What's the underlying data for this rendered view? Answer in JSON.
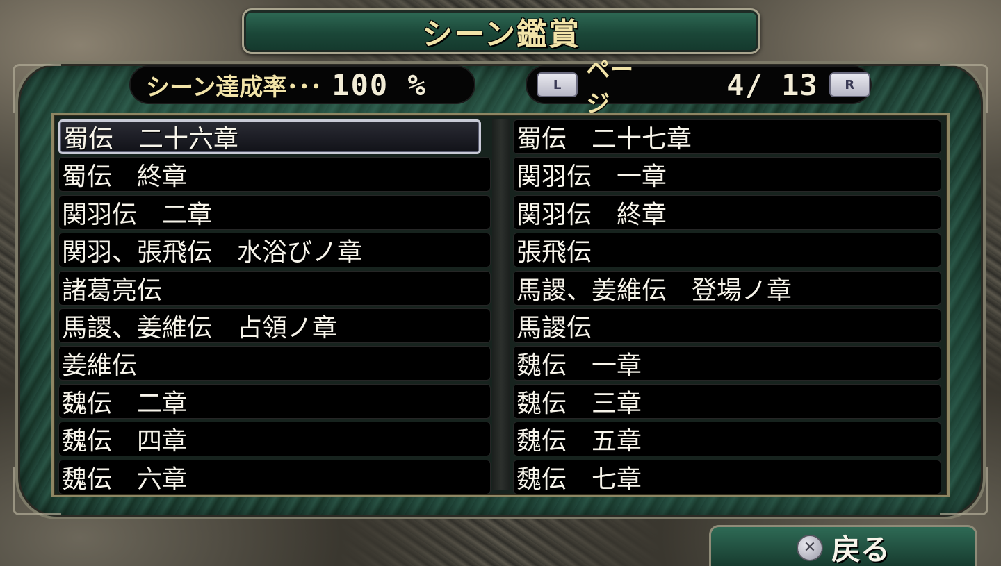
{
  "title": "シーン鑑賞",
  "completion": {
    "label": "シーン達成率･･･",
    "value": "100 %"
  },
  "pager": {
    "l_button": "L",
    "label": "ページ",
    "value": "4/ 13",
    "r_button": "R"
  },
  "scenes": {
    "left": [
      "蜀伝　二十六章",
      "蜀伝　終章",
      "関羽伝　二章",
      "関羽、張飛伝　水浴びノ章",
      "諸葛亮伝",
      "馬謖、姜維伝　占領ノ章",
      "姜維伝",
      "魏伝　二章",
      "魏伝　四章",
      "魏伝　六章"
    ],
    "right": [
      "蜀伝　二十七章",
      "関羽伝　一章",
      "関羽伝　終章",
      "張飛伝",
      "馬謖、姜維伝　登場ノ章",
      "馬謖伝",
      "魏伝　一章",
      "魏伝　三章",
      "魏伝　五章",
      "魏伝　七章"
    ]
  },
  "back": {
    "icon": "cross-button-icon",
    "label": "戻る"
  }
}
